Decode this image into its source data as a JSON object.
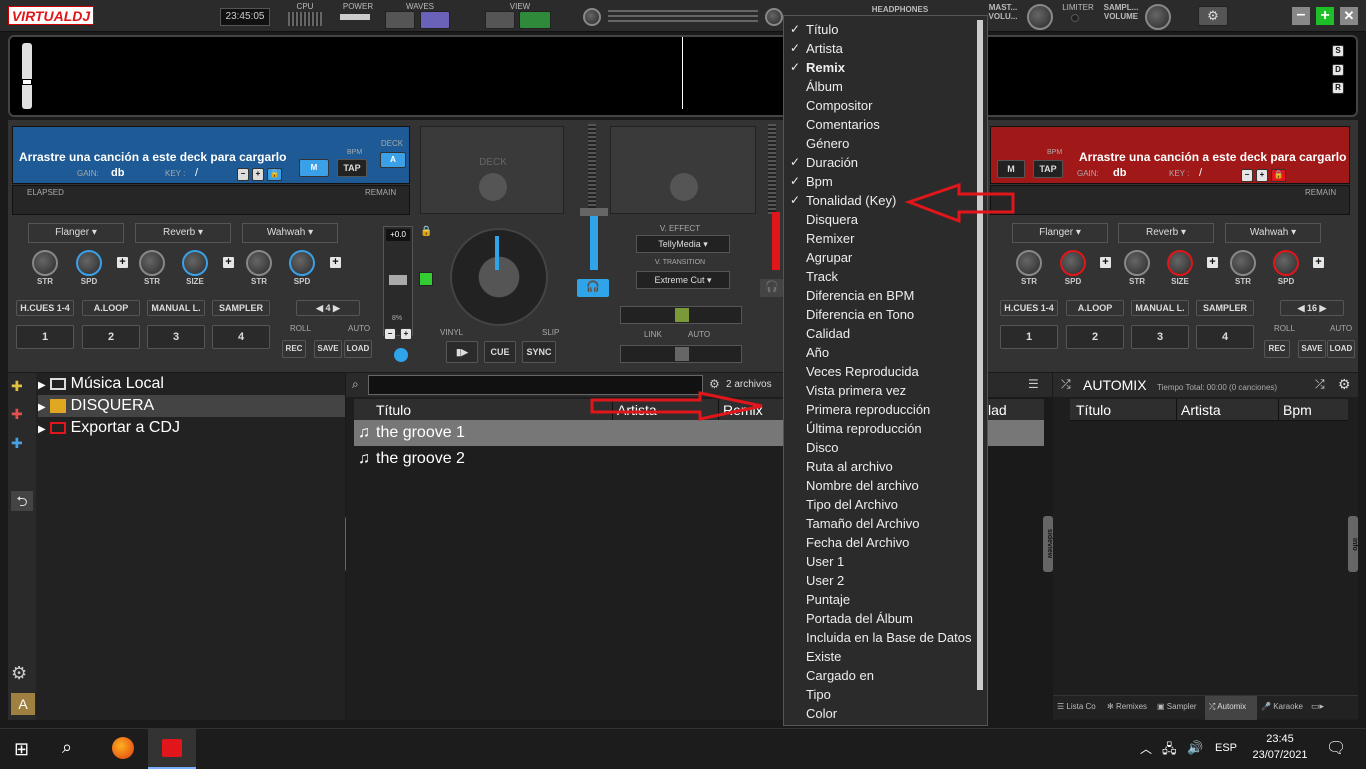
{
  "app": {
    "logo": "VIRTUALDJ",
    "clock": "23:45:05"
  },
  "top_labels": {
    "cpu": "CPU",
    "power": "POWER",
    "waves": "WAVES",
    "view": "VIEW",
    "headphones": "HEADPHONES",
    "master_vol": "MAST... VOLU...",
    "limiter": "LIMITER",
    "sampler_vol": "SAMPL... VOLUME"
  },
  "side_letters": [
    "S",
    "D",
    "R"
  ],
  "deck_left": {
    "title": "Arrastre una canción a este deck para cargarlo",
    "gain_label": "GAIN:",
    "gain": "db",
    "key_label": "KEY :",
    "key": "/",
    "bpm_label": "BPM",
    "deck_label": "DECK",
    "deck_letter": "A",
    "m": "M",
    "tap": "TAP",
    "elapsed": "ELAPSED",
    "remain": "REMAIN"
  },
  "deck_right": {
    "title": "Arrastre una canción a este deck para cargarlo",
    "gain_label": "GAIN:",
    "gain": "db",
    "key_label": "KEY :",
    "key": "/",
    "bpm_label": "BPM",
    "m": "M",
    "tap": "TAP",
    "remain": "REMAIN"
  },
  "center": {
    "deck_label": "DECK",
    "v_effect": "V. EFFECT",
    "v_effect_value": "TellyMedia",
    "v_transition": "V. TRANSITION",
    "v_transition_value": "Extreme Cut",
    "link": "LINK",
    "auto": "AUTO",
    "vinyl": "VINYL",
    "slip": "SLIP",
    "cue": "CUE",
    "sync": "SYNC",
    "pitch": "+0.0",
    "pitch_range": "8%"
  },
  "fx_left": [
    "Flanger",
    "Reverb",
    "Wahwah"
  ],
  "fx_right": [
    "Flanger",
    "Reverb",
    "Wahwah"
  ],
  "knob_labels_left": [
    "STR",
    "SPD",
    "STR",
    "SIZE",
    "STR",
    "SPD"
  ],
  "knob_labels_right": [
    "STR",
    "SPD",
    "STR",
    "SIZE",
    "STR",
    "SPD"
  ],
  "pads_left": {
    "modes": [
      "H.CUES 1-4",
      "A.LOOP",
      "MANUAL L.",
      "SAMPLER"
    ],
    "nums": [
      "1",
      "2",
      "3",
      "4"
    ],
    "loop": "4",
    "roll": "ROLL",
    "auto": "AUTO",
    "rec": "REC",
    "save": "SAVE",
    "load": "LOAD"
  },
  "pads_right": {
    "modes": [
      "H.CUES 1-4",
      "A.LOOP",
      "MANUAL L.",
      "SAMPLER"
    ],
    "nums": [
      "1",
      "2",
      "3",
      "4"
    ],
    "loop": "16",
    "roll": "ROLL",
    "auto": "AUTO",
    "rec": "REC",
    "save": "SAVE",
    "load": "LOAD"
  },
  "tree": [
    {
      "label": "Música Local"
    },
    {
      "label": "DISQUERA"
    },
    {
      "label": "Exportar a CDJ"
    }
  ],
  "browser": {
    "files_count": "2 archivos",
    "columns": [
      "Título",
      "Artista",
      "Remix",
      "lad (Key)"
    ],
    "rows": [
      "the  groove 1",
      "the groove 2"
    ],
    "folders_tab": "folders"
  },
  "automix": {
    "title": "AUTOMIX",
    "subtitle": "Tiempo Total: 00:00 (0 canciones)",
    "columns": [
      "Título",
      "Artista",
      "Bpm"
    ],
    "sideview": "sideview",
    "info": "info",
    "tabs": [
      "Lista Co",
      "Remixes",
      "Sampler",
      "Automix",
      "Karaoke"
    ]
  },
  "menu": [
    {
      "label": "Título",
      "checked": true
    },
    {
      "label": "Artista",
      "checked": true
    },
    {
      "label": "Remix",
      "checked": true,
      "bold": true
    },
    {
      "label": "Álbum"
    },
    {
      "label": "Compositor"
    },
    {
      "label": "Comentarios"
    },
    {
      "label": "Género"
    },
    {
      "label": "Duración",
      "checked": true
    },
    {
      "label": "Bpm",
      "checked": true
    },
    {
      "label": "Tonalidad (Key)",
      "checked": true
    },
    {
      "label": "Disquera"
    },
    {
      "label": "Remixer"
    },
    {
      "label": "Agrupar"
    },
    {
      "label": "Track"
    },
    {
      "label": "Diferencia en BPM"
    },
    {
      "label": "Diferencia en Tono"
    },
    {
      "label": "Calidad"
    },
    {
      "label": "Año"
    },
    {
      "label": "Veces Reproducida"
    },
    {
      "label": "Vista primera vez"
    },
    {
      "label": "Primera reproducción"
    },
    {
      "label": "Última reproducción"
    },
    {
      "label": "Disco"
    },
    {
      "label": "Ruta al archivo"
    },
    {
      "label": "Nombre del archivo"
    },
    {
      "label": "Tipo del Archivo"
    },
    {
      "label": "Tamaño del Archivo"
    },
    {
      "label": "Fecha del Archivo"
    },
    {
      "label": "User 1"
    },
    {
      "label": "User 2"
    },
    {
      "label": "Puntaje"
    },
    {
      "label": "Portada del Álbum"
    },
    {
      "label": "Incluida en la Base de Datos"
    },
    {
      "label": "Existe"
    },
    {
      "label": "Cargado en"
    },
    {
      "label": "Tipo"
    },
    {
      "label": "Color"
    }
  ],
  "taskbar": {
    "lang": "ESP",
    "time": "23:45",
    "date": "23/07/2021"
  },
  "colors": {
    "deck_left": "#1d5a96",
    "deck_right": "#a11818",
    "arrow": "#e0161b"
  }
}
